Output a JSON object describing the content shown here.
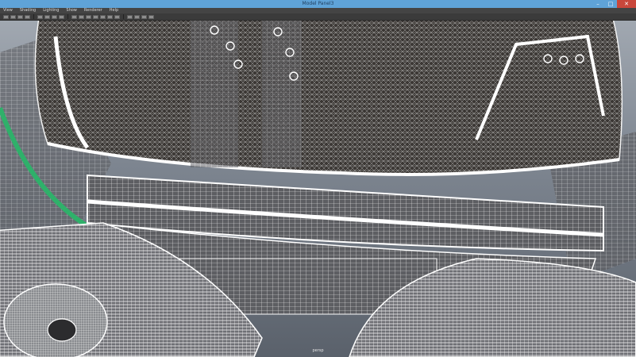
{
  "window": {
    "title": "Model Panel3",
    "controls": [
      {
        "name": "minimize",
        "glyph": "–"
      },
      {
        "name": "maximize",
        "glyph": "□"
      },
      {
        "name": "close",
        "glyph": "✕"
      }
    ]
  },
  "menubar": {
    "items": [
      "View",
      "Shading",
      "Lighting",
      "Show",
      "Renderer",
      "Help"
    ]
  },
  "toolbar": {
    "icons": [
      "select-camera-icon",
      "camera-attributes-icon",
      "bookmark-icon",
      "image-plane-icon",
      "grid-icon",
      "film-gate-icon",
      "resolution-gate-icon",
      "gate-mask-icon",
      "wireframe-icon",
      "smooth-shade-icon",
      "wireframe-on-shaded-icon",
      "textured-icon",
      "lights-icon",
      "shadows-icon",
      "ambient-occlusion-icon",
      "isolate-select-icon",
      "xray-icon",
      "xray-joints-icon",
      "hud-icon"
    ]
  },
  "viewport": {
    "camera_label": "persp",
    "colors": {
      "mesh_dark": "#3b3734",
      "wire": "#f2f2f2",
      "accent_green": "#2fb06a",
      "background_top": "#a1a8b1",
      "background_bottom": "#5a616b"
    }
  }
}
